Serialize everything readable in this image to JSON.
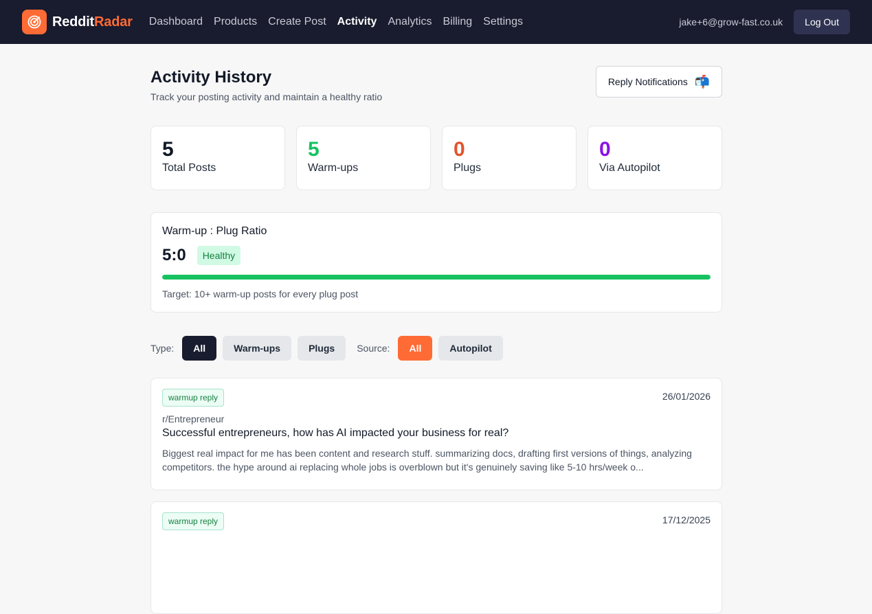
{
  "brand": {
    "name_part1": "Reddit",
    "name_part2": "Radar",
    "logo_icon": "radar-target-icon",
    "accent": "#ff6b35"
  },
  "nav": {
    "items": [
      {
        "label": "Dashboard"
      },
      {
        "label": "Products"
      },
      {
        "label": "Create Post"
      },
      {
        "label": "Activity",
        "active": true
      },
      {
        "label": "Analytics"
      },
      {
        "label": "Billing"
      },
      {
        "label": "Settings"
      }
    ],
    "user_email": "jake+6@grow-fast.co.uk",
    "logout_label": "Log Out"
  },
  "page": {
    "title": "Activity History",
    "subtitle": "Track your posting activity and maintain a healthy ratio",
    "notifications_button": "Reply Notifications",
    "notifications_icon": "mailbox-icon"
  },
  "stats": [
    {
      "value": "5",
      "label": "Total Posts",
      "color": "#111827"
    },
    {
      "value": "5",
      "label": "Warm-ups",
      "color": "#16c25f"
    },
    {
      "value": "0",
      "label": "Plugs",
      "color": "#e0552b"
    },
    {
      "value": "0",
      "label": "Via Autopilot",
      "color": "#8b12e6"
    }
  ],
  "ratio": {
    "title": "Warm-up : Plug Ratio",
    "value": "5:0",
    "status": "Healthy",
    "progress_percent": 100,
    "target_text": "Target: 10+ warm-up posts for every plug post"
  },
  "filters": {
    "type_label": "Type:",
    "type_options": [
      "All",
      "Warm-ups",
      "Plugs"
    ],
    "type_selected": "All",
    "source_label": "Source:",
    "source_options": [
      "All",
      "Autopilot"
    ],
    "source_selected": "All"
  },
  "posts": [
    {
      "tag": "warmup reply",
      "date": "26/01/2026",
      "subreddit": "r/Entrepreneur",
      "title": "Successful entrepreneurs, how has AI impacted your business for real?",
      "excerpt": "Biggest real impact for me has been content and research stuff. summarizing docs, drafting first versions of things, analyzing competitors. the hype around ai replacing whole jobs is overblown but it's genuinely saving like 5-10 hrs/week o..."
    },
    {
      "tag": "warmup reply",
      "date": "17/12/2025"
    }
  ]
}
